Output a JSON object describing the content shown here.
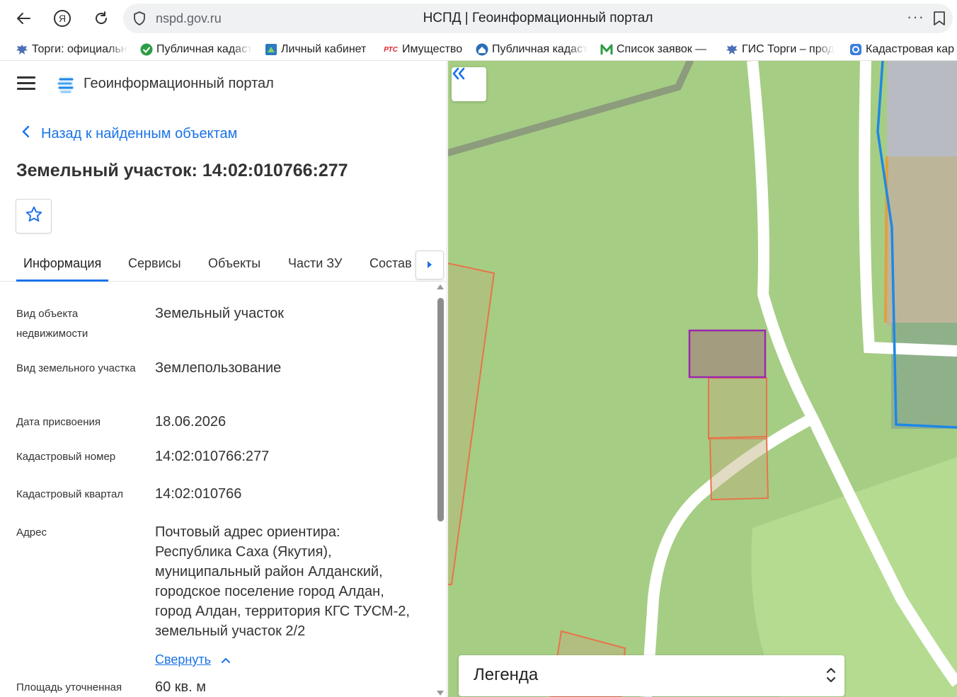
{
  "browser": {
    "url": "nspd.gov.ru",
    "tab_title": "НСПД | Геоинформационный портал",
    "more": "···"
  },
  "bookmarks": [
    {
      "label": "Торги: официальн",
      "icon": "eagle-icon"
    },
    {
      "label": "Публичная кадаст",
      "icon": "green-check-icon"
    },
    {
      "label": "Личный кабинет",
      "icon": "rosreestr-icon"
    },
    {
      "label": "Имущество",
      "icon": "rts-icon",
      "badge": "РТС"
    },
    {
      "label": "Публичная кадаст",
      "icon": "house-icon"
    },
    {
      "label": "Список заявок —",
      "icon": "m-logo-icon"
    },
    {
      "label": "ГИС Торги – прод",
      "icon": "eagle-icon"
    },
    {
      "label": "Кадастровая кар",
      "icon": "map-app-icon"
    }
  ],
  "header": {
    "title": "Геоинформационный портал"
  },
  "nav": {
    "back_label": "Назад к найденным объектам"
  },
  "object": {
    "title": "Земельный участок: 14:02:010766:277"
  },
  "tabs": [
    {
      "label": "Информация",
      "active": true
    },
    {
      "label": "Сервисы",
      "active": false
    },
    {
      "label": "Объекты",
      "active": false
    },
    {
      "label": "Части ЗУ",
      "active": false
    },
    {
      "label": "Состав",
      "active": false
    }
  ],
  "properties": [
    {
      "label": "Вид объекта недвижимости",
      "value": "Земельный участок"
    },
    {
      "label": "Вид земельного участка",
      "value": "Землепользование"
    },
    {
      "label": "Дата присвоения",
      "value": "18.06.2026"
    },
    {
      "label": "Кадастровый номер",
      "value": "14:02:010766:277"
    },
    {
      "label": "Кадастровый квартал",
      "value": "14:02:010766"
    },
    {
      "label": "Адрес",
      "value": "Почтовый адрес ориентира: Республика Саха (Якутия), муниципальный район Алданский, городское поселение город Алдан, город Алдан, территория КГС ТУСМ-2, земельный участок 2/2"
    },
    {
      "label": "Площадь уточненная",
      "value": "60 кв. м"
    }
  ],
  "address_toggle": "Свернуть",
  "legend": {
    "title": "Легенда"
  },
  "colors": {
    "accent": "#1a73e8",
    "map_bg": "#a6cd84",
    "parcel_selected": "#9c27b0",
    "parcel_border": "#e8734a",
    "boundary_blue": "#1e88e5"
  }
}
